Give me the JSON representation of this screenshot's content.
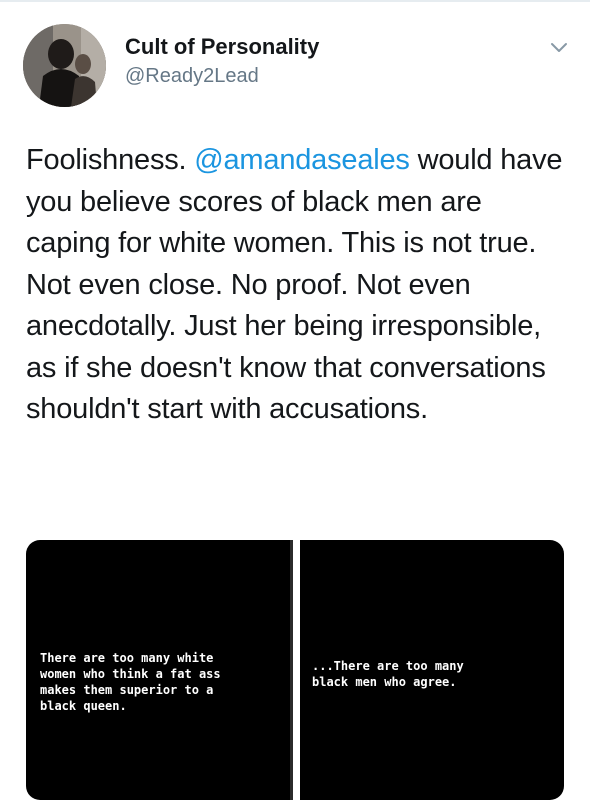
{
  "tweet": {
    "display_name": "Cult of Personality",
    "handle": "@Ready2Lead",
    "text_before": "Foolishness. ",
    "mention": "@amandaseales",
    "text_after": " would have you believe scores of black men are caping for white women. This is not true. Not even close. No proof. Not even anecdotally. Just her being irresponsible, as if she doesn't know that conversations shouldn't start with accusations.",
    "menu_icon": "chevron-down-icon",
    "mention_color": "#1b95e0"
  },
  "media": {
    "left_text": "There are too many white\nwomen who think a fat ass\nmakes them superior to a\nblack queen.",
    "right_text": "...There are too many\nblack men who agree."
  }
}
